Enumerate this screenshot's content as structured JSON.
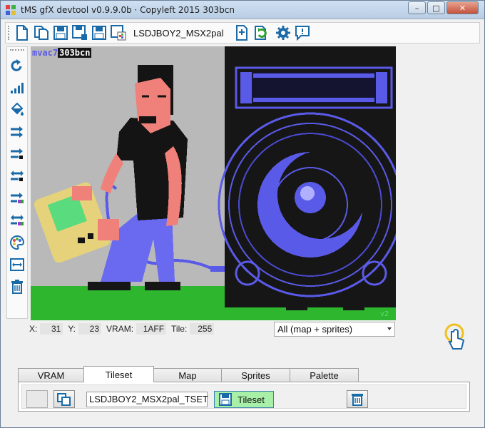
{
  "window": {
    "title": "tMS gfX devtool v0.9.9.0b · Copyleft 2015 303bcn",
    "controls": {
      "minimize": "–",
      "maximize": "□",
      "close": "✕"
    }
  },
  "toolbar": {
    "icons": [
      "new-file-icon",
      "copy-file-icon",
      "save-icon",
      "save-as-icon",
      "save-all-icon",
      "save-image-icon",
      "export-icon",
      "reload-file-icon",
      "settings-icon",
      "help-icon"
    ],
    "project_name": "LSDJBOY2_MSX2pal"
  },
  "side_toolbar": {
    "icons": [
      "undo-icon",
      "signal-icon",
      "paint-bucket-icon",
      "swap-right-icon",
      "swap-left-icon",
      "swap-both-icon",
      "swap-color-icon",
      "swap-color-both-icon",
      "palette-icon",
      "resize-icon",
      "trash-icon"
    ]
  },
  "canvas": {
    "credit_author": "mvac7",
    "credit_group": "303bcn",
    "corner_tag": "v2"
  },
  "status": {
    "x_label": "X:",
    "x_value": "31",
    "y_label": "Y:",
    "y_value": "23",
    "vram_label": "VRAM:",
    "vram_value": "1AFF",
    "tile_label": "Tile:",
    "tile_value": "255"
  },
  "view_select": {
    "value": "All (map + sprites)"
  },
  "pointer": {
    "icon": "hand-pointer-icon"
  },
  "tabs": [
    {
      "label": "VRAM",
      "active": false
    },
    {
      "label": "Tileset",
      "active": true
    },
    {
      "label": "Map",
      "active": false
    },
    {
      "label": "Sprites",
      "active": false
    },
    {
      "label": "Palette",
      "active": false
    }
  ],
  "tileset_panel": {
    "name_value": "LSDJBOY2_MSX2pal_TSET",
    "save_label": "Tileset"
  },
  "colors": {
    "speaker_blue": "#5a5ae8",
    "grass_green": "#2eb62e",
    "skin": "#f0807a",
    "shirt": "#141414",
    "jeans": "#6a6af0",
    "gameboy": "#e6d27a",
    "gameboy_screen": "#5adb7e",
    "save_button": "#a8f0a8"
  }
}
